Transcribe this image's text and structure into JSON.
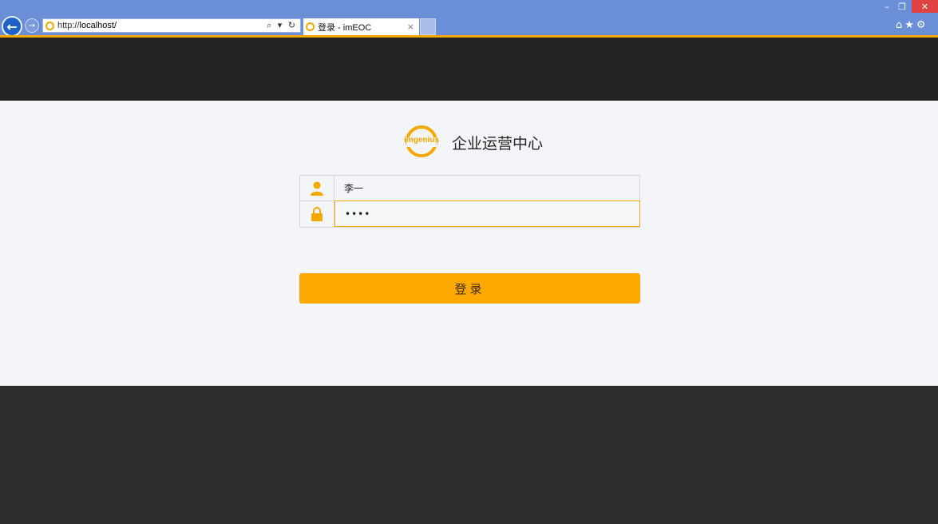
{
  "browser": {
    "url_prefix": "http://",
    "url_host": "localhost/",
    "address_icons": "⌕ ▾ ↻",
    "tab_title": "登录 - imEOC",
    "tab_close": "×",
    "window_controls": {
      "minimize": "–",
      "maximize": "❐",
      "close": "✕"
    },
    "toolbar_icons": "⌂★⚙"
  },
  "brand": {
    "logo_text": "imgenius",
    "app_name": "企业运营中心"
  },
  "login": {
    "username_value": "李一",
    "password_value": "1234",
    "submit_label": "登录"
  },
  "colors": {
    "accent": "#ffa800",
    "chrome": "#6b8fd6",
    "top_band": "#232323",
    "bottom_band": "#2d2d2d",
    "page_bg": "#f4f5f8"
  },
  "icons": {
    "user": "user-icon",
    "lock": "lock-icon",
    "back": "back-arrow-icon",
    "forward": "forward-arrow-icon"
  }
}
